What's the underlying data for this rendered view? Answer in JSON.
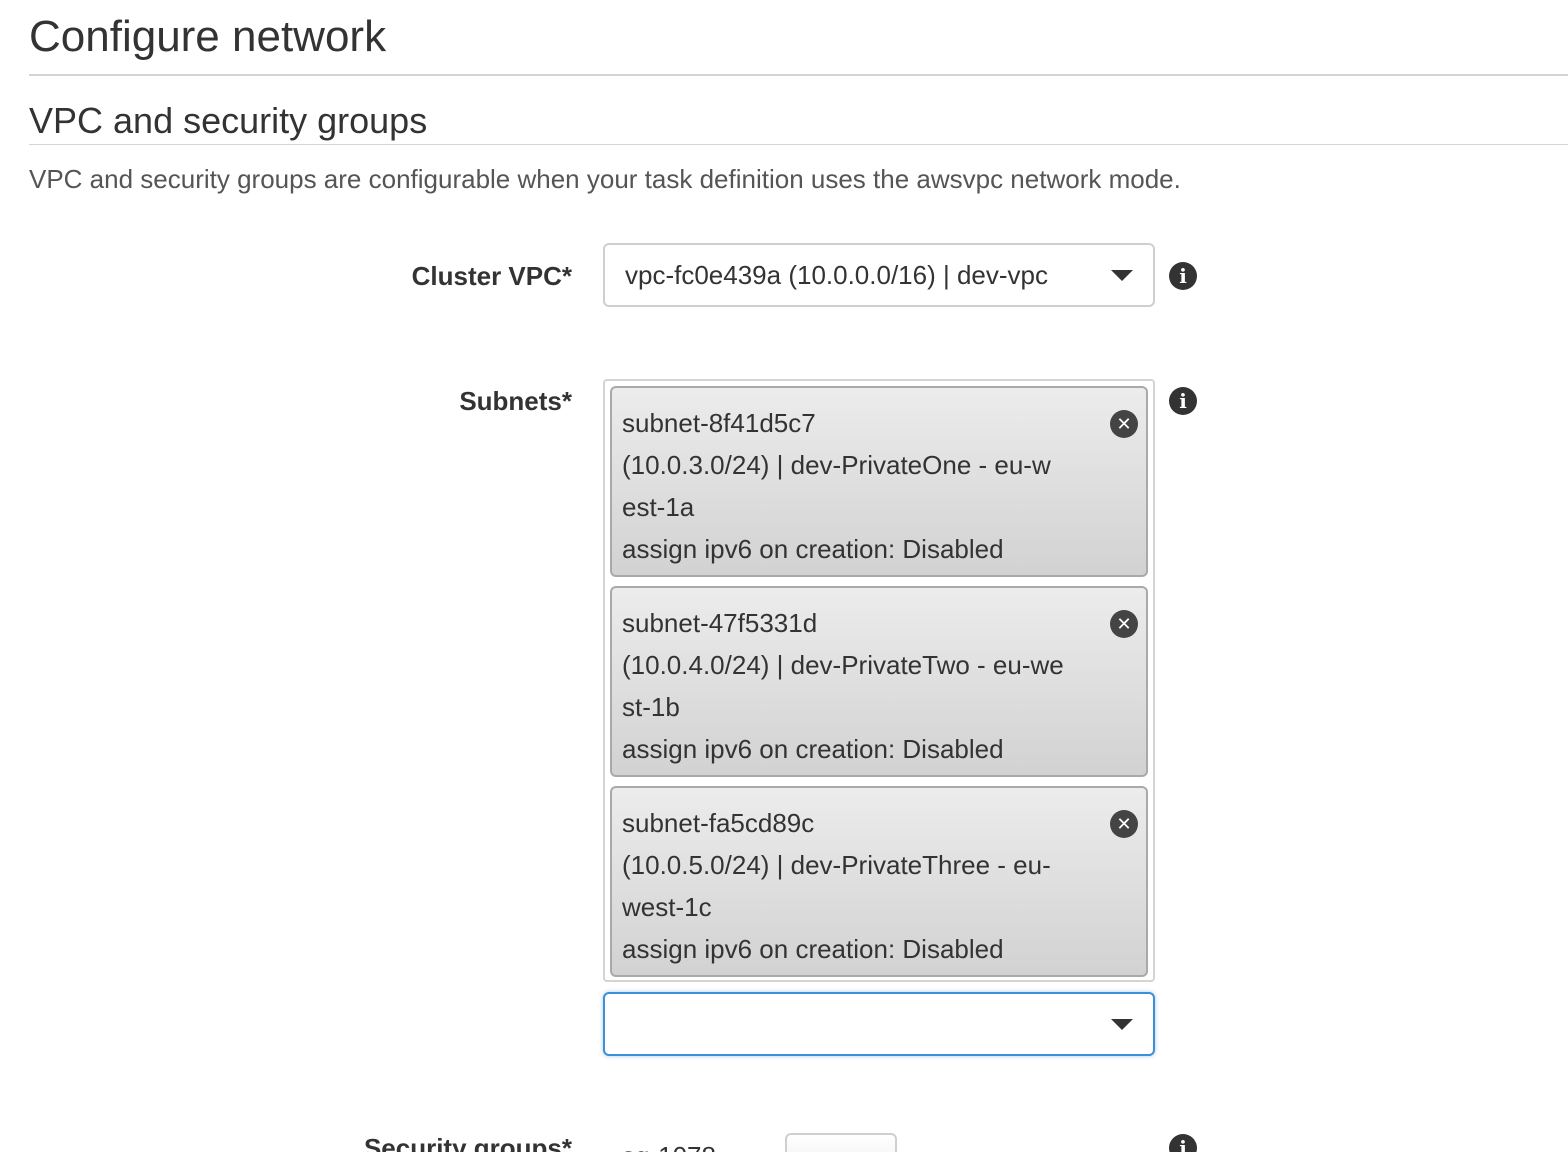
{
  "page": {
    "title": "Configure network"
  },
  "section": {
    "title": "VPC and security groups",
    "description": "VPC and security groups are configurable when your task definition uses the awsvpc network mode."
  },
  "cluster_vpc": {
    "label": "Cluster VPC*",
    "value": "vpc-fc0e439a (10.0.0.0/16) | dev-vpc",
    "info_icon": "info-icon",
    "dropdown_icon": "caret-down-icon"
  },
  "subnets": {
    "label": "Subnets*",
    "info_icon": "info-icon",
    "selected": [
      {
        "lines": [
          "subnet-8f41d5c7",
          "(10.0.3.0/24) | dev-PrivateOne - eu-w",
          "est-1a",
          "assign ipv6 on creation: Disabled"
        ],
        "remove_icon": "close-icon"
      },
      {
        "lines": [
          "subnet-47f5331d",
          "(10.0.4.0/24) | dev-PrivateTwo - eu-we",
          "st-1b",
          "assign ipv6 on creation: Disabled"
        ],
        "remove_icon": "close-icon"
      },
      {
        "lines": [
          "subnet-fa5cd89c",
          "(10.0.5.0/24) | dev-PrivateThree - eu-",
          "west-1c",
          "assign ipv6 on creation: Disabled"
        ],
        "remove_icon": "close-icon"
      }
    ],
    "add_select_value": ""
  },
  "security_groups": {
    "label": "Security groups*",
    "partial_text": "sg-1078",
    "info_icon": "info-icon"
  },
  "colors": {
    "focus_border": "#3d8fd6",
    "chip_border": "#a9a9a9",
    "text": "#333333"
  }
}
